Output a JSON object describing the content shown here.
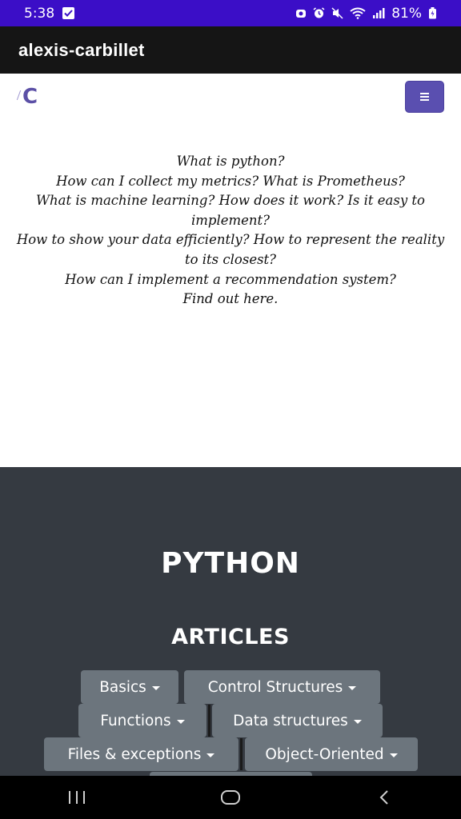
{
  "status_bar": {
    "time": "5:38",
    "battery": "81%",
    "icons": [
      "check-notification-icon",
      "screen-recorder-icon",
      "alarm-icon",
      "mute-icon",
      "wifi-icon",
      "signal-icon",
      "battery-icon"
    ]
  },
  "app_bar": {
    "title": "alexis-carbillet"
  },
  "navbar": {
    "logo_letter": "C",
    "menu_icon": "hamburger-menu-icon",
    "accent_color": "#5a4fb0"
  },
  "intro": {
    "lines": [
      "What is python?",
      "How can I collect my metrics? What is Prometheus?",
      "What is machine learning? How does it work? Is it easy to implement?",
      "How to show your data efficiently? How to represent the reality to its closest?",
      "How can I implement a recommendation system?",
      "Find out here."
    ]
  },
  "section": {
    "title": "PYTHON",
    "subtitle": "ARTICLES",
    "buttons": [
      "Basics",
      "Control Structures",
      "Functions",
      "Data structures",
      "Files & exceptions",
      "Object-Oriented"
    ],
    "background_color": "#353a41",
    "button_color": "#6c757d"
  },
  "system_nav": {
    "icons": [
      "recent-apps-icon",
      "home-icon",
      "back-icon"
    ]
  }
}
